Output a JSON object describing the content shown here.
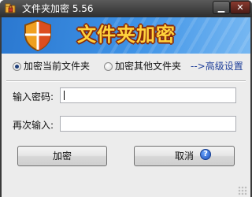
{
  "window": {
    "title": "文件夹加密 5.56",
    "minimize_glyph": "▁",
    "close_glyph": "✕"
  },
  "banner": {
    "title": "文件夹加密"
  },
  "mode": {
    "options": [
      {
        "label": "加密当前文件夹",
        "selected": true
      },
      {
        "label": "加密其他文件夹",
        "selected": false
      }
    ],
    "advanced_link": "-->高级设置"
  },
  "form": {
    "password_label": "输入密码:",
    "password_value": "",
    "confirm_label": "再次输入:",
    "confirm_value": ""
  },
  "buttons": {
    "encrypt": "加密",
    "cancel": "取消"
  },
  "help": {
    "glyph": "?"
  },
  "colors": {
    "banner_text": "#ffd23c",
    "banner_outline": "#8a2b0a",
    "banner_bg": "#3f93e6",
    "link": "#1f3f9a"
  },
  "icons": [
    "app-lock-icon",
    "shield-check-icon",
    "help-icon"
  ]
}
